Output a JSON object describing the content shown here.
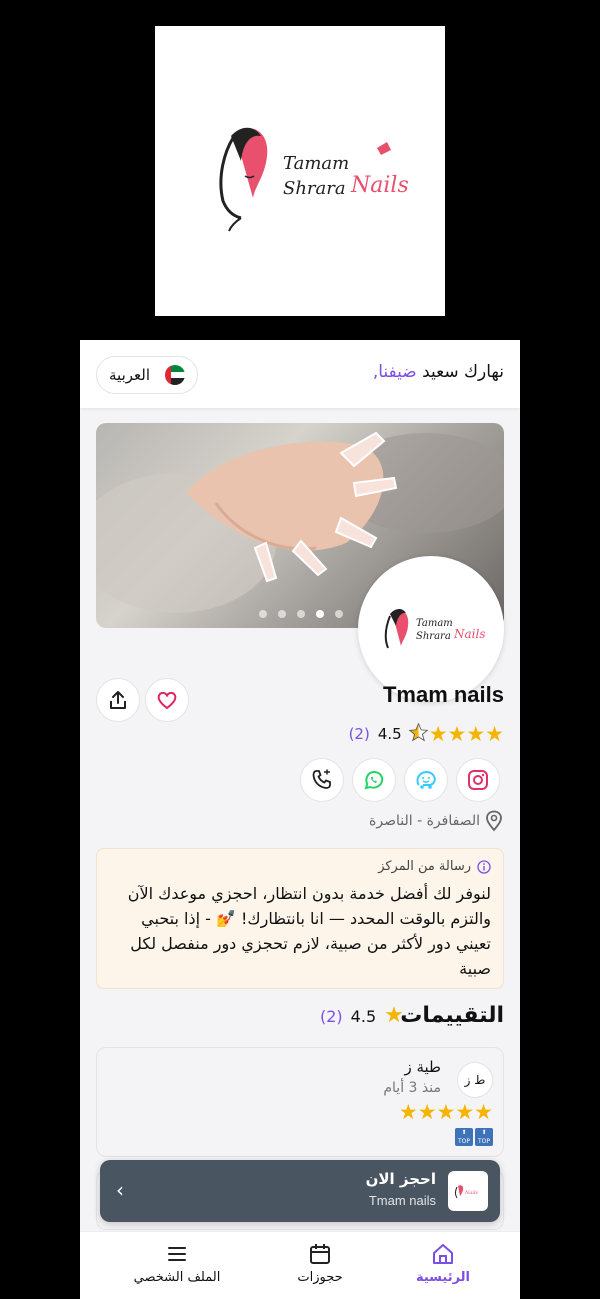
{
  "logo": {
    "line1": "Tamam",
    "line2": "Shrara",
    "script": "Nails"
  },
  "header": {
    "greeting": "نهارك سعيد",
    "guest": "ضيفنا,",
    "language_label": "العربية",
    "flag_icon": "uae-flag-icon"
  },
  "hero": {
    "slides": 5,
    "active_slide": 4
  },
  "salon": {
    "name": "Tmam nails",
    "rating": "4.5",
    "rating_count": "(2)",
    "stars": 4.5,
    "location": "الصفافرة - الناصرة",
    "actions": [
      "share-icon",
      "heart-icon"
    ],
    "socials": [
      "instagram-icon",
      "waze-icon",
      "whatsapp-icon",
      "phone-icon"
    ]
  },
  "message": {
    "title": "رسالة من المركز",
    "body": "لنوفر لك أفضل خدمة بدون انتظار، احجزي موعدك الآن والتزم بالوقت المحدد — انا بانتظارك! 💅 - إذا بتحبي تعيني دور لأكثر من صبية، لازم تحجزي دور منفصل لكل صبية"
  },
  "reviews": {
    "heading": "التقييمات",
    "rating": "4.5",
    "count": "(2)",
    "items": [
      {
        "initials": "ط ز",
        "name": "طية ز",
        "time": "منذ 3 أيام",
        "stars": 5,
        "badge": "TOP"
      }
    ]
  },
  "booking_bar": {
    "title": "احجز الان",
    "subtitle": "Tmam nails"
  },
  "nav": {
    "home": "الرئيسية",
    "bookings": "حجوزات",
    "profile": "الملف الشخصي"
  },
  "colors": {
    "accent": "#7b4fe6",
    "star": "#f5b400",
    "booking_bar": "#495560",
    "message_bg": "#fdf5ea",
    "logo_pink": "#e8506e"
  }
}
